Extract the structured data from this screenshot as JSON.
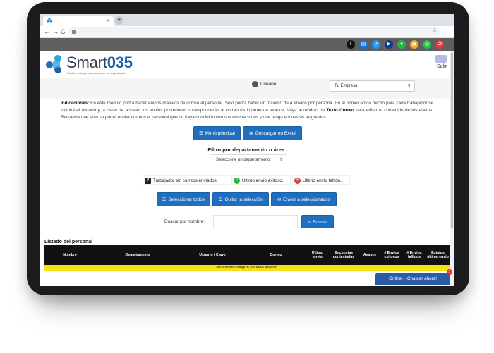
{
  "browser": {
    "tab_close": "×",
    "new_tab": "+",
    "back": "←",
    "forward": "→",
    "reload": "C",
    "menu": "⋮"
  },
  "social_icons": [
    {
      "name": "info-icon",
      "glyph": "i",
      "color": "#111111"
    },
    {
      "name": "doc-icon",
      "glyph": "",
      "color": "#1976d2"
    },
    {
      "name": "help-icon",
      "glyph": "?",
      "color": "#2196f3"
    },
    {
      "name": "youtube-icon",
      "glyph": "▶",
      "color": "#0b3d91"
    },
    {
      "name": "chat-icon",
      "glyph": "",
      "color": "#2db24a"
    },
    {
      "name": "mail-icon",
      "glyph": "",
      "color": "#f5a623"
    },
    {
      "name": "whatsapp-icon",
      "glyph": "",
      "color": "#28c44f"
    },
    {
      "name": "power-icon",
      "glyph": "",
      "color": "#e53935"
    }
  ],
  "header": {
    "logo_word": "Smart",
    "logo_num": "035",
    "tagline": "Evalúe el riesgo psicosocial de su organización",
    "salir": "Salir"
  },
  "userbar": {
    "user_label": "Usuario",
    "company": "Tu Empresa",
    "caret": "⌃⌄"
  },
  "instructions": {
    "label": "Indicaciones:",
    "text1": " En este módulo podrá hacer envíos masivos de correo al personal. Sólo podrá hacer un máximo de 4 envíos por persona. En el primer envío hecho para cada trabajador se incluirá el usuario y la clave de acceso, los envíos posteriores corresponderán al correo de informe de avance. Vaya al módulo de ",
    "bold": "Texto Correo",
    "text2": " para editar el contenido de los envíos. Recuerde que solo se podrá enviar correos al personal que no haya concluido con sus evaluaciones y que tenga encuestas asignadas."
  },
  "buttons": {
    "menu": "Menú principal",
    "excel": "Descargar en Excel",
    "select_all": "Seleccionar todos",
    "remove_selection": "Quitar la selección",
    "send_selected": "Enviar a seleccionados",
    "search": "Buscar"
  },
  "filter": {
    "label": "Filtro por departamento o área:",
    "placeholder": "Seleccione un departamento"
  },
  "legend": {
    "no_emails": "Trabajador sin correos enviados.",
    "last_success": "Último envío exitoso.",
    "last_failed": "Último envío fallido."
  },
  "search": {
    "label": "Buscar por nombre:"
  },
  "table": {
    "title": "Listado del personal",
    "headers": [
      "Nombre",
      "Departamento",
      "Usuario / Clave",
      "Correo",
      "Último envío",
      "Encuestas contestadas",
      "Avance",
      "# Envíos exitosos",
      "# Envíos fallidos",
      "Estatus último envío"
    ],
    "empty_message": "No existen ningún periodo abierto."
  },
  "chat": {
    "label": "Online - ¡Chatear ahora!",
    "badge": "1"
  }
}
